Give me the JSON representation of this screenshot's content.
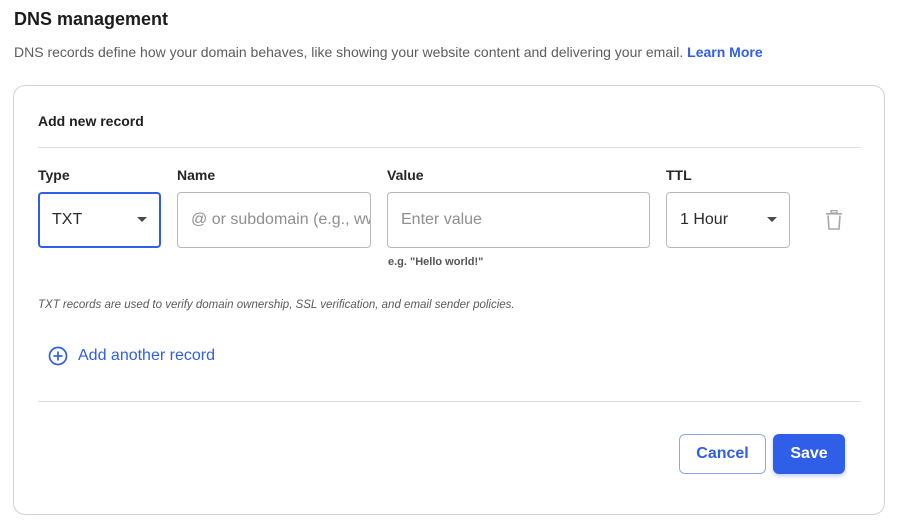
{
  "header": {
    "title": "DNS management",
    "description": "DNS records define how your domain behaves, like showing your website content and delivering your email.",
    "learn_more": "Learn More"
  },
  "card": {
    "title": "Add new record",
    "fields": {
      "type": {
        "label": "Type",
        "value": "TXT"
      },
      "name": {
        "label": "Name",
        "placeholder": "@ or subdomain (e.g., www)"
      },
      "value": {
        "label": "Value",
        "placeholder": "Enter value",
        "hint": "e.g. \"Hello world!\""
      },
      "ttl": {
        "label": "TTL",
        "value": "1 Hour"
      }
    },
    "info": "TXT records are used to verify domain ownership, SSL verification, and email sender policies.",
    "add_another": "Add another record",
    "cancel_label": "Cancel",
    "save_label": "Save"
  },
  "colors": {
    "accent": "#2f5ee8",
    "border": "#b9b9b9"
  },
  "icons": {
    "delete": "trash-icon",
    "add": "plus-circle-icon",
    "dropdown": "caret-down-icon"
  }
}
